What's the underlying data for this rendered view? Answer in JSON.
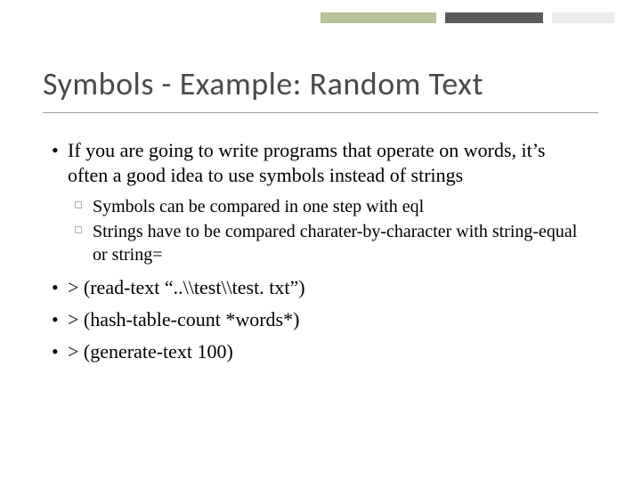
{
  "slide": {
    "title": "Symbols - Example: Random Text",
    "bullets": [
      {
        "text": "If you are going to write programs that operate on words, it’s often a good idea to use symbols instead of strings",
        "sub": [
          "Symbols can be compared in one step with eql",
          "Strings have to be compared charater-by-character with string-equal or string="
        ]
      },
      {
        "text": "> (read-text “..\\\\test\\\\test. txt”)"
      },
      {
        "text": "> (hash-table-count *words*)"
      },
      {
        "text": "> (generate-text 100)"
      }
    ]
  }
}
